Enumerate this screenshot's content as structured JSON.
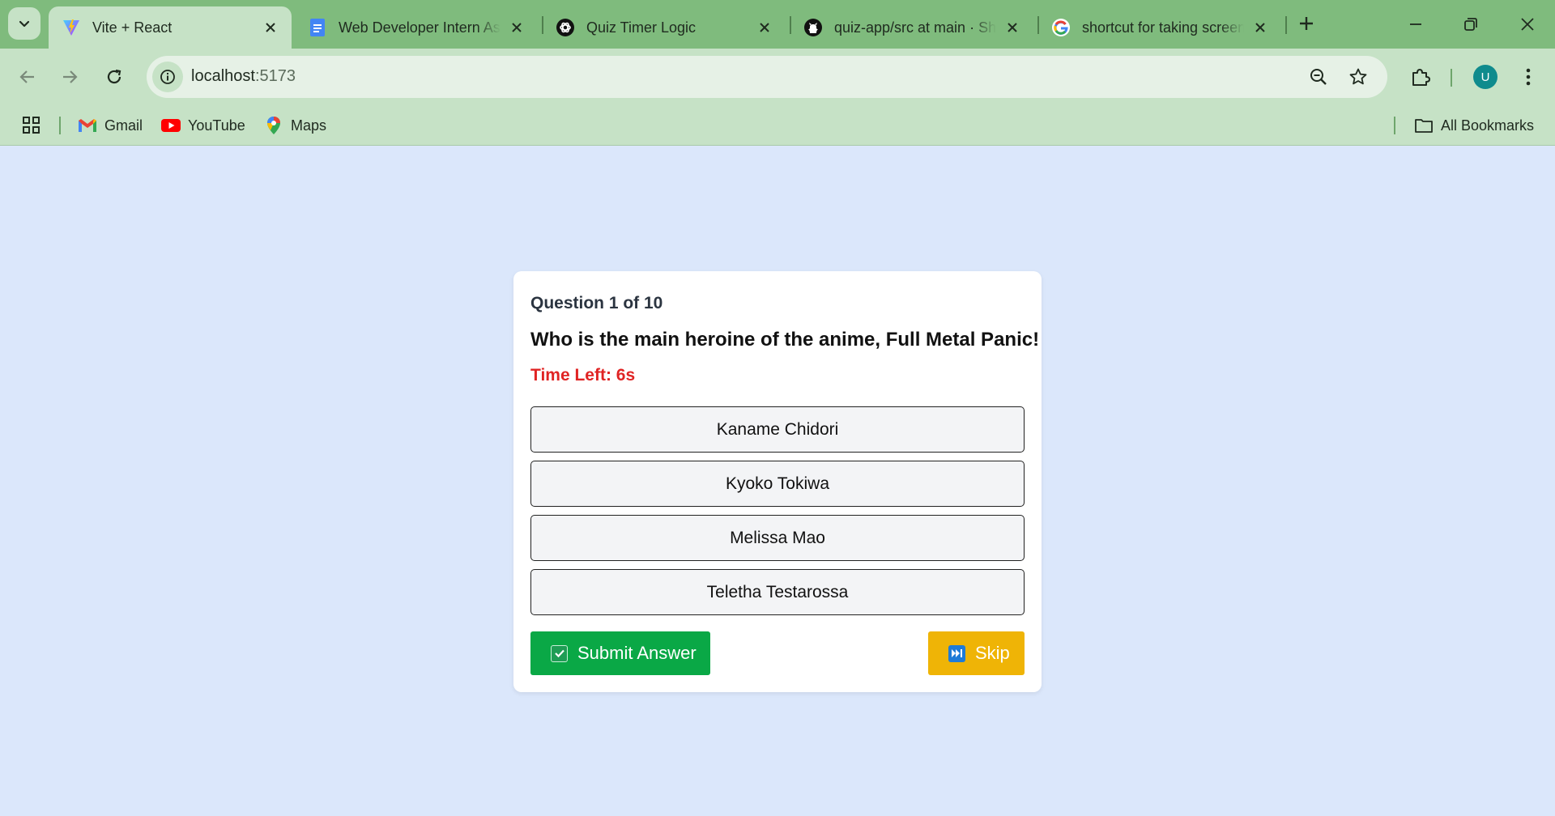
{
  "browser": {
    "tabs": [
      {
        "title": "Vite + React",
        "icon": "vite-icon",
        "active": true
      },
      {
        "title": "Web Developer Intern Assignment",
        "icon": "google-docs-icon",
        "active": false
      },
      {
        "title": "Quiz Timer Logic",
        "icon": "chatgpt-icon",
        "active": false
      },
      {
        "title": "quiz-app/src at main · Sh",
        "icon": "github-icon",
        "active": false
      },
      {
        "title": "shortcut for taking screenshot",
        "icon": "google-icon",
        "active": false
      }
    ],
    "url_host": "localhost",
    "url_port": ":5173",
    "avatar_letter": "U",
    "bookmarks": [
      {
        "label": "Gmail",
        "icon": "gmail-icon"
      },
      {
        "label": "YouTube",
        "icon": "youtube-icon"
      },
      {
        "label": "Maps",
        "icon": "maps-icon"
      }
    ],
    "all_bookmarks_label": "All Bookmarks"
  },
  "quiz": {
    "question_counter": "Question 1 of 10",
    "question": "Who is the main heroine of the anime, Full Metal Panic!",
    "timer": "Time Left: 6s",
    "options": [
      "Kaname Chidori",
      "Kyoko Tokiwa",
      "Melissa Mao",
      "Teletha Testarossa"
    ],
    "submit_label": "Submit Answer",
    "skip_label": "Skip"
  },
  "colors": {
    "page_background": "#dbe7fb",
    "tab_strip": "#7fbb7d",
    "toolbar": "#c6e2c6",
    "submit_button": "#0aa846",
    "skip_button": "#efb406",
    "timer_text": "#e02424"
  }
}
